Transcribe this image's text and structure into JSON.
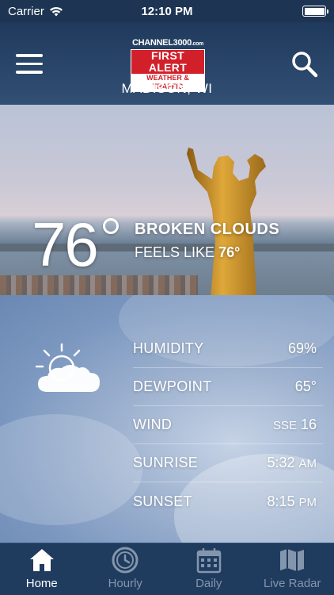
{
  "status_bar": {
    "carrier": "Carrier",
    "time": "12:10 PM"
  },
  "header": {
    "logo": {
      "channel": "CHANNEL3000",
      "channel_suffix": ".com",
      "line1": "FIRST ALERT",
      "line2": "WEATHER & TRAFFIC"
    },
    "location": "MADISON, WI",
    "menu_icon": "hamburger-icon",
    "search_icon": "search-icon"
  },
  "current": {
    "temperature": "76",
    "condition": "BROKEN CLOUDS",
    "feels_like_label": "FEELS LIKE",
    "feels_like_value": "76°"
  },
  "details": {
    "icon": "partly-cloudy-icon",
    "rows": [
      {
        "label": "HUMIDITY",
        "value": "69%",
        "unit": ""
      },
      {
        "label": "DEWPOINT",
        "value": "65°",
        "unit": ""
      },
      {
        "label": "WIND",
        "prefix": "SSE",
        "value": "16",
        "unit": ""
      },
      {
        "label": "SUNRISE",
        "value": "5:32",
        "unit": "AM"
      },
      {
        "label": "SUNSET",
        "value": "8:15",
        "unit": "PM"
      }
    ]
  },
  "tabs": [
    {
      "label": "Home",
      "icon": "home-icon",
      "active": true
    },
    {
      "label": "Hourly",
      "icon": "clock-icon",
      "active": false
    },
    {
      "label": "Daily",
      "icon": "calendar-icon",
      "active": false
    },
    {
      "label": "Live Radar",
      "icon": "map-icon",
      "active": false
    }
  ],
  "colors": {
    "header_bg": "#1f3a5c",
    "tabbar_bg": "#1f3b5e",
    "brand_red": "#d2202a",
    "tab_inactive": "#8496ad"
  }
}
